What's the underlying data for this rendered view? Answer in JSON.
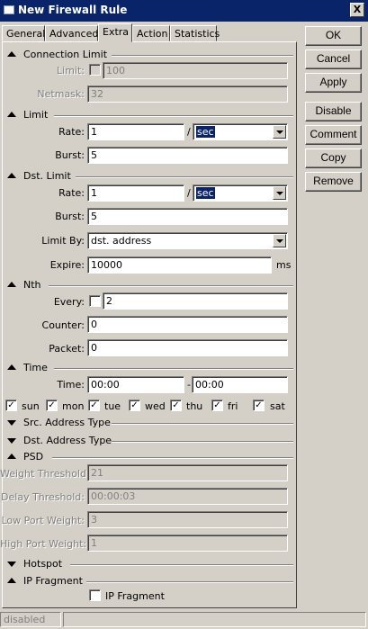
{
  "window": {
    "title": "New Firewall Rule",
    "close_glyph": "X",
    "icon": "window-app-icon"
  },
  "tabs": [
    "General",
    "Advanced",
    "Extra",
    "Action",
    "Statistics"
  ],
  "side_buttons": [
    "OK",
    "Cancel",
    "Apply",
    "Disable",
    "Comment",
    "Copy",
    "Remove"
  ],
  "sections": {
    "connection_limit": "Connection Limit",
    "limit": "Limit",
    "dst_limit": "Dst. Limit",
    "nth": "Nth",
    "time": "Time",
    "src_address_type": "Src. Address Type",
    "dst_address_type": "Dst. Address Type",
    "psd": "PSD",
    "hotspot": "Hotspot",
    "ip_fragment": "IP Fragment"
  },
  "connection_limit": {
    "limit_label": "Limit:",
    "limit_value": "100",
    "netmask_label": "Netmask:",
    "netmask_value": "32"
  },
  "limit": {
    "rate_label": "Rate:",
    "rate_value": "1",
    "sep": "/",
    "unit": "sec",
    "burst_label": "Burst:",
    "burst_value": "5"
  },
  "dst_limit": {
    "rate_label": "Rate:",
    "rate_value": "1",
    "sep": "/",
    "unit": "sec",
    "burst_label": "Burst:",
    "burst_value": "5",
    "limit_by_label": "Limit By:",
    "limit_by_value": "dst. address",
    "expire_label": "Expire:",
    "expire_value": "10000",
    "expire_unit": "ms"
  },
  "nth": {
    "every_label": "Every:",
    "every_value": "2",
    "counter_label": "Counter:",
    "counter_value": "0",
    "packet_label": "Packet:",
    "packet_value": "0"
  },
  "time": {
    "time_label": "Time:",
    "from": "00:00",
    "sep": "-",
    "to": "00:00",
    "days": [
      "sun",
      "mon",
      "tue",
      "wed",
      "thu",
      "fri",
      "sat"
    ],
    "check_glyph": "✓"
  },
  "psd": {
    "weight_threshold_label": "Weight Threshold:",
    "weight_threshold_value": "21",
    "delay_threshold_label": "Delay Threshold:",
    "delay_threshold_value": "00:00:03",
    "low_port_weight_label": "Low Port Weight:",
    "low_port_weight_value": "3",
    "high_port_weight_label": "High Port Weight:",
    "high_port_weight_value": "1"
  },
  "ip_fragment": {
    "checkbox_label": "IP Fragment"
  },
  "status": {
    "text": "disabled"
  }
}
